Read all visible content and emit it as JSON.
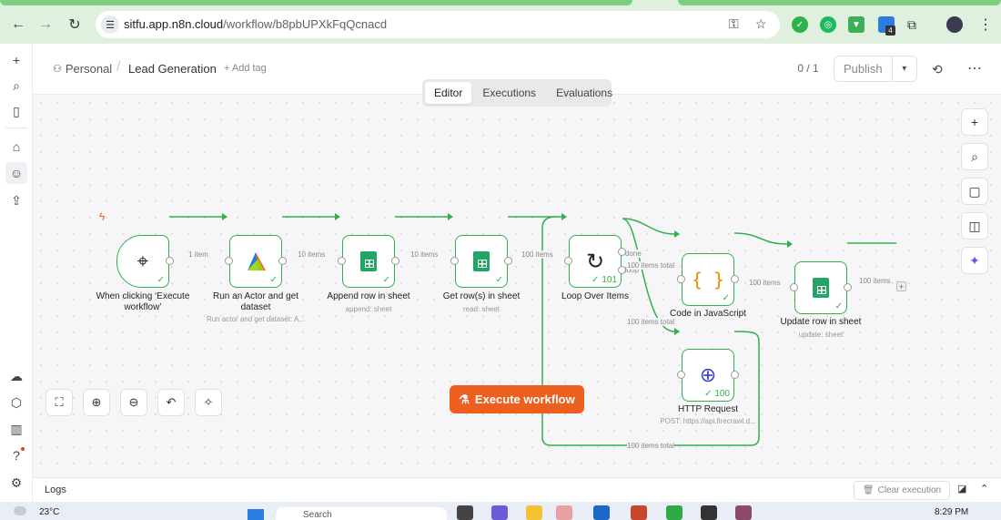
{
  "browser": {
    "url_host": "sitfu.app.n8n.cloud",
    "url_path": "/workflow/b8pbUPXkFqQcnacd",
    "ext_badge": "4"
  },
  "topbar": {
    "project": "Personal",
    "workflow_name": "Lead Generation",
    "add_tag": "+ Add tag",
    "counter": "0 / 1",
    "publish": "Publish"
  },
  "view_tabs": [
    "Editor",
    "Executions",
    "Evaluations"
  ],
  "nodes": {
    "trigger": {
      "title": "When clicking ‘Execute workflow’"
    },
    "actor": {
      "title": "Run an Actor and get dataset",
      "subtitle": "Run actor and get dataset: A..."
    },
    "append": {
      "title": "Append row in sheet",
      "subtitle": "append: sheet"
    },
    "getrows": {
      "title": "Get row(s) in sheet",
      "subtitle": "read: sheet"
    },
    "loop": {
      "title": "Loop Over Items",
      "badge": "101"
    },
    "code": {
      "title": "Code in JavaScript"
    },
    "update": {
      "title": "Update row in sheet",
      "subtitle": "update: sheet"
    },
    "http": {
      "title": "HTTP Request",
      "subtitle": "POST: https://api.firecrawl.d...",
      "badge": "100"
    }
  },
  "edges": {
    "e1": "1 item",
    "e2": "10 items",
    "e3": "10 items",
    "e4": "100 items",
    "done": "done",
    "loop": "loop",
    "loop_code": "100 items total",
    "loop_http": "100 items total",
    "code_update": "100 items",
    "update_out": "100 items",
    "http_back": "100 items total"
  },
  "execute_button": "Execute workflow",
  "logs": {
    "label": "Logs",
    "clear": "Clear execution"
  },
  "taskbar": {
    "weather": "23°C",
    "search": "Search",
    "time": "8:29 PM"
  },
  "colors": {
    "accent": "#ec5f1e",
    "success": "#31b14a",
    "sheets": "#23a566"
  }
}
